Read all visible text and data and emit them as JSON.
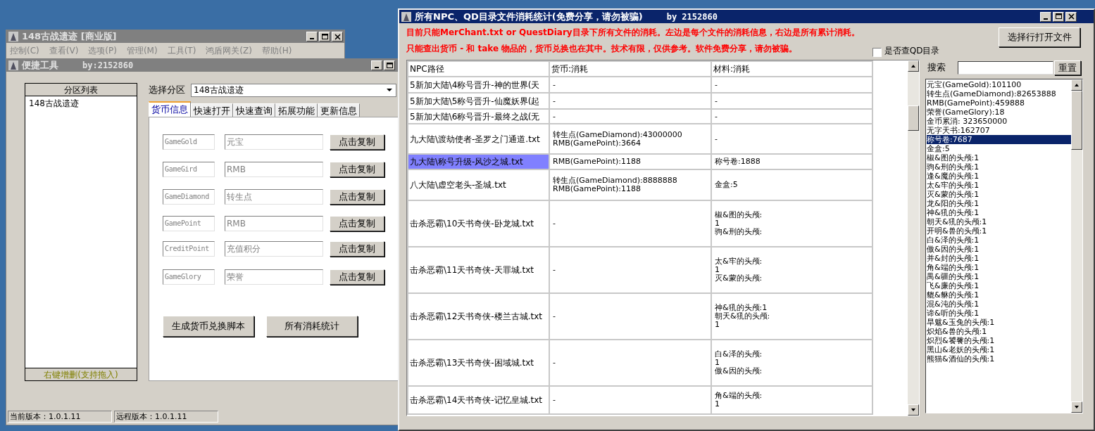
{
  "main_window": {
    "title": "148古战遗迹 [商业版]",
    "active": false,
    "menu": [
      "控制(C)",
      "查看(V)",
      "选项(P)",
      "管理(M)",
      "工具(T)",
      "鸿盾网关(Z)",
      "帮助(H)"
    ]
  },
  "tool_window": {
    "title": "便捷工具",
    "author": "by:2152860",
    "active": false,
    "partition_list": {
      "header": "分区列表",
      "items": [
        {
          "label": "148古战遗迹",
          "selected": false
        }
      ],
      "footer": "右键增删(支持拖入)"
    },
    "partition_select": {
      "label": "选择分区",
      "value": "148古战遗迹"
    },
    "tabs": [
      {
        "label": "货币信息",
        "selected": true
      },
      {
        "label": "快速打开",
        "selected": false
      },
      {
        "label": "快速查询",
        "selected": false
      },
      {
        "label": "拓展功能",
        "selected": false
      },
      {
        "label": "更新信息",
        "selected": false
      }
    ],
    "currency_rows": [
      {
        "code": "GameGold",
        "name": "元宝",
        "button": "点击复制"
      },
      {
        "code": "GameGird",
        "name": "RMB",
        "button": "点击复制"
      },
      {
        "code": "GameDiamond",
        "name": "转生点",
        "button": "点击复制"
      },
      {
        "code": "GamePoint",
        "name": "RMB",
        "button": "点击复制"
      },
      {
        "code": "CreditPoint",
        "name": "充值积分",
        "button": "点击复制"
      },
      {
        "code": "GameGlory",
        "name": "荣誉",
        "button": "点击复制"
      }
    ],
    "buttons": [
      "生成货币兑换脚本",
      "所有消耗统计"
    ],
    "status_bar": [
      "当前版本：1.0.1.11",
      "远程版本：1.0.1.11"
    ]
  },
  "stats_window": {
    "title": "所有NPC、QD目录文件消耗统计(免费分享，请勿被骗)",
    "author": "by 2152860",
    "active": true,
    "notes": [
      "目前只能MerChant.txt or QuestDiary目录下所有文件的消耗。左边是每个文件的消耗信息，右边是所有累计消耗。",
      "只能查出货币 - 和 take 物品的，货币兑换也在其中。技术有限，仅供参考。软件免费分享，请勿被骗。"
    ],
    "checkbox": {
      "label": "是否查QD目录",
      "checked": false
    },
    "open_button": "选择行打开文件",
    "table": {
      "columns": [
        "NPC路径",
        "货币:消耗",
        "材料:消耗"
      ],
      "rows": [
        {
          "path": "5新加大陆\\4称号晋升-神的世界(天",
          "currency": [
            "-"
          ],
          "materials": [
            "-"
          ],
          "selected": false
        },
        {
          "path": "5新加大陆\\5称号晋升-仙魔妖界(起",
          "currency": [
            "-"
          ],
          "materials": [
            "-"
          ],
          "selected": false
        },
        {
          "path": "5新加大陆\\6称号晋升-最终之战(无",
          "currency": [
            "-"
          ],
          "materials": [
            "-"
          ],
          "selected": false
        },
        {
          "path": "九大陆\\渡劫使者-圣罗之门通道.txt",
          "currency": [
            "转生点(GameDiamond):43000000",
            "RMB(GamePoint):3664"
          ],
          "materials": [
            "-"
          ],
          "selected": false
        },
        {
          "path": "九大陆\\称号升级-风沙之城.txt",
          "currency": [
            "RMB(GamePoint):1188"
          ],
          "materials": [
            "称号卷:1888"
          ],
          "selected": true
        },
        {
          "path": "八大陆\\虚空老头-圣城.txt",
          "currency": [
            "转生点(GameDiamond):8888888",
            "RMB(GamePoint):1188"
          ],
          "materials": [
            "金盒:5"
          ],
          "selected": false
        },
        {
          "path": "击杀恶霸\\10天书奇侠-卧龙城.txt",
          "currency": [
            "-"
          ],
          "materials": [
            "椒&图的头颅:",
            "1",
            "驹&刑的头颅:"
          ],
          "selected": false
        },
        {
          "path": "击杀恶霸\\11天书奇侠-天罪城.txt",
          "currency": [
            "-"
          ],
          "materials": [
            "太&牢的头颅:",
            "1",
            "灭&蒙的头颅:"
          ],
          "selected": false
        },
        {
          "path": "击杀恶霸\\12天书奇侠-楼兰古城.txt",
          "currency": [
            "-"
          ],
          "materials": [
            "神&犼的头颅:1",
            "朝天&犼的头颅:",
            "1"
          ],
          "selected": false
        },
        {
          "path": "击杀恶霸\\13天书奇侠-困域城.txt",
          "currency": [
            "-"
          ],
          "materials": [
            "白&泽的头颅:",
            "1",
            "傲&因的头颅:"
          ],
          "selected": false
        },
        {
          "path": "击杀恶霸\\14天书奇侠-记忆皇城.txt",
          "currency": [
            "-"
          ],
          "materials": [
            "角&端的头颅:",
            "1"
          ],
          "selected": false
        }
      ]
    },
    "search": {
      "label": "搜索",
      "button": "重置"
    },
    "totals": [
      {
        "label": "元宝(GameGold):101100",
        "selected": false
      },
      {
        "label": "转生点(GameDiamond):82653888",
        "selected": false
      },
      {
        "label": "RMB(GamePoint):459888",
        "selected": false
      },
      {
        "label": "荣誉(GameGlory):18",
        "selected": false
      },
      {
        "label": "金币累消: 323650000",
        "selected": false
      },
      {
        "label": "无字天书:162707",
        "selected": false
      },
      {
        "label": "称号卷:7687",
        "selected": true
      },
      {
        "label": "金盒:5",
        "selected": false
      },
      {
        "label": "椒&图的头颅:1",
        "selected": false
      },
      {
        "label": "驹&刑的头颅:1",
        "selected": false
      },
      {
        "label": "逢&魔的头颅:1",
        "selected": false
      },
      {
        "label": "太&牢的头颅:1",
        "selected": false
      },
      {
        "label": "灭&蒙的头颅:1",
        "selected": false
      },
      {
        "label": "龙&阳的头颅:1",
        "selected": false
      },
      {
        "label": "神&犼的头颅:1",
        "selected": false
      },
      {
        "label": "朝天&犼的头颅:1",
        "selected": false
      },
      {
        "label": "开明&兽的头颅:1",
        "selected": false
      },
      {
        "label": "白&泽的头颅:1",
        "selected": false
      },
      {
        "label": "傲&因的头颅:1",
        "selected": false
      },
      {
        "label": "并&封的头颅:1",
        "selected": false
      },
      {
        "label": "角&端的头颅:1",
        "selected": false
      },
      {
        "label": "禺&疆的头颅:1",
        "selected": false
      },
      {
        "label": "飞&廉的头颅:1",
        "selected": false
      },
      {
        "label": "貔&貅的头颅:1",
        "selected": false
      },
      {
        "label": "混&沌的头颅:1",
        "selected": false
      },
      {
        "label": "谛&听的头颅:1",
        "selected": false
      },
      {
        "label": "旱魃&玉兔的头颅:1",
        "selected": false
      },
      {
        "label": "炽焰&兽的头颅:1",
        "selected": false
      },
      {
        "label": "炽烈&饕餮的头颅:1",
        "selected": false
      },
      {
        "label": "黑山&老妖的头颅:1",
        "selected": false
      },
      {
        "label": "熊猫&酒仙的头颅:1",
        "selected": false
      }
    ]
  }
}
